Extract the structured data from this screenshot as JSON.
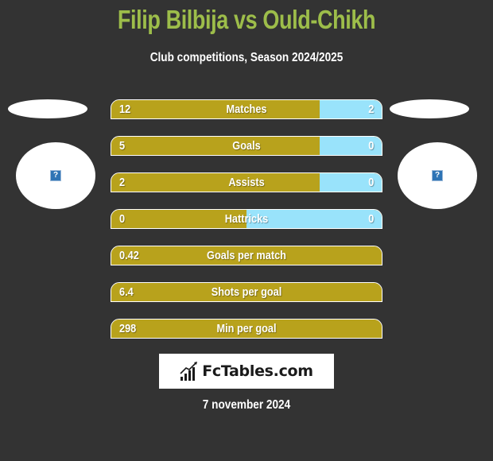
{
  "header": {
    "title": "Filip Bilbija vs Ould-Chikh",
    "subtitle": "Club competitions, Season 2024/2025"
  },
  "players": {
    "left": {
      "avatar_icon": "question-mark-icon",
      "avatar_glyph": "?"
    },
    "right": {
      "avatar_icon": "question-mark-icon",
      "avatar_glyph": "?"
    }
  },
  "colors": {
    "title": "#9dbd4a",
    "left_bar": "#b8a21c",
    "right_bar": "#99e3fb",
    "background": "#333333"
  },
  "stats": [
    {
      "label": "Matches",
      "left": "12",
      "right": "2",
      "left_share": 0.77,
      "has_right": true
    },
    {
      "label": "Goals",
      "left": "5",
      "right": "0",
      "left_share": 0.77,
      "has_right": true
    },
    {
      "label": "Assists",
      "left": "2",
      "right": "0",
      "left_share": 0.77,
      "has_right": true
    },
    {
      "label": "Hattricks",
      "left": "0",
      "right": "0",
      "left_share": 0.5,
      "has_right": true
    },
    {
      "label": "Goals per match",
      "left": "0.42",
      "right": "",
      "left_share": 1.0,
      "has_right": false
    },
    {
      "label": "Shots per goal",
      "left": "6.4",
      "right": "",
      "left_share": 1.0,
      "has_right": false
    },
    {
      "label": "Min per goal",
      "left": "298",
      "right": "",
      "left_share": 1.0,
      "has_right": false
    }
  ],
  "footer": {
    "logo_text": "FcTables.com",
    "logo_icon": "bar-chart-icon",
    "date": "7 november 2024"
  }
}
